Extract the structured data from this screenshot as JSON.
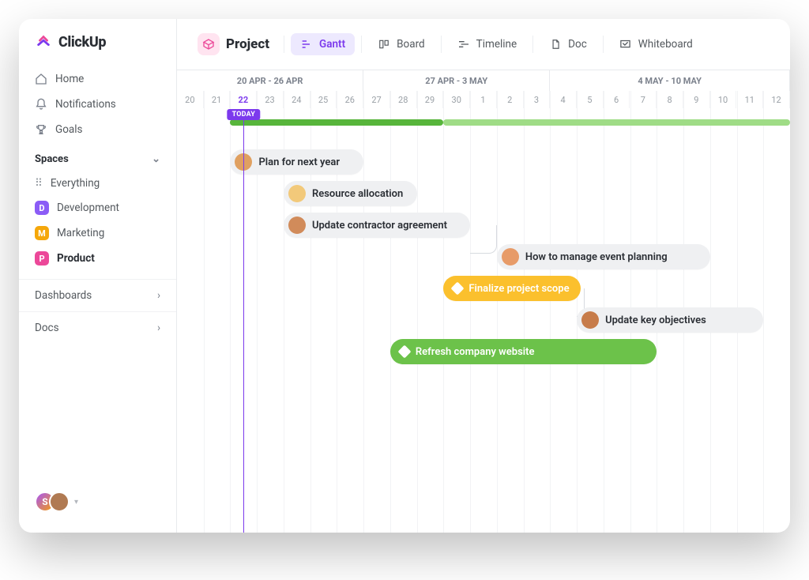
{
  "brand": {
    "name": "ClickUp"
  },
  "sidebar": {
    "nav": [
      {
        "label": "Home",
        "icon": "home"
      },
      {
        "label": "Notifications",
        "icon": "bell"
      },
      {
        "label": "Goals",
        "icon": "trophy"
      }
    ],
    "spaces_header": "Spaces",
    "spaces": [
      {
        "label": "Everything",
        "icon": "dots",
        "color": ""
      },
      {
        "label": "Development",
        "badge": "D",
        "color": "#8b5cf6"
      },
      {
        "label": "Marketing",
        "badge": "M",
        "color": "#f5a70a"
      },
      {
        "label": "Product",
        "badge": "P",
        "color": "#ec4899",
        "active": true
      }
    ],
    "sections": [
      {
        "label": "Dashboards"
      },
      {
        "label": "Docs"
      }
    ],
    "presence": {
      "initial": "S"
    }
  },
  "toolbar": {
    "project_label": "Project",
    "views": [
      {
        "label": "Gantt",
        "icon": "gantt",
        "active": true
      },
      {
        "label": "Board",
        "icon": "board"
      },
      {
        "label": "Timeline",
        "icon": "timeline"
      },
      {
        "label": "Doc",
        "icon": "doc"
      },
      {
        "label": "Whiteboard",
        "icon": "whiteboard"
      }
    ]
  },
  "timeline": {
    "week_labels": [
      "20 APR - 26 APR",
      "27 APR - 3 MAY",
      "4 MAY - 10 MAY"
    ],
    "days": [
      "20",
      "21",
      "22",
      "23",
      "24",
      "25",
      "26",
      "27",
      "28",
      "29",
      "30",
      "1",
      "2",
      "3",
      "4",
      "5",
      "6",
      "7",
      "8",
      "9",
      "10",
      "11",
      "12"
    ],
    "today_index": 2,
    "today_label": "TODAY",
    "tasks": [
      {
        "id": "plan",
        "label": "Plan for next year",
        "style": "gray",
        "avatar": "#e0a060",
        "start": 2,
        "span": 5,
        "row": 0
      },
      {
        "id": "resource",
        "label": "Resource allocation",
        "style": "gray",
        "avatar": "#f2c97a",
        "start": 4,
        "span": 5,
        "row": 1
      },
      {
        "id": "contractor",
        "label": "Update contractor agreement",
        "style": "gray",
        "avatar": "#d18b5a",
        "start": 4,
        "span": 7,
        "row": 2
      },
      {
        "id": "event",
        "label": "How to manage event planning",
        "style": "gray",
        "avatar": "#e79b68",
        "start": 12,
        "span": 8,
        "row": 3
      },
      {
        "id": "scope",
        "label": "Finalize project scope",
        "style": "yellow",
        "diamond": "#ffffff",
        "start": 10,
        "span": 5,
        "row": 4
      },
      {
        "id": "objectives",
        "label": "Update key objectives",
        "style": "gray",
        "avatar": "#c77c4a",
        "start": 15,
        "span": 7,
        "row": 5
      },
      {
        "id": "website",
        "label": "Refresh company website",
        "style": "green",
        "diamond": "#ffffff",
        "start": 8,
        "span": 10,
        "row": 6
      }
    ]
  },
  "colors": {
    "accent": "#7c3aed",
    "pink": "#ec4899",
    "yellow": "#fbc02d",
    "green_dark": "#57b53b",
    "green_light": "#9fdc86"
  }
}
